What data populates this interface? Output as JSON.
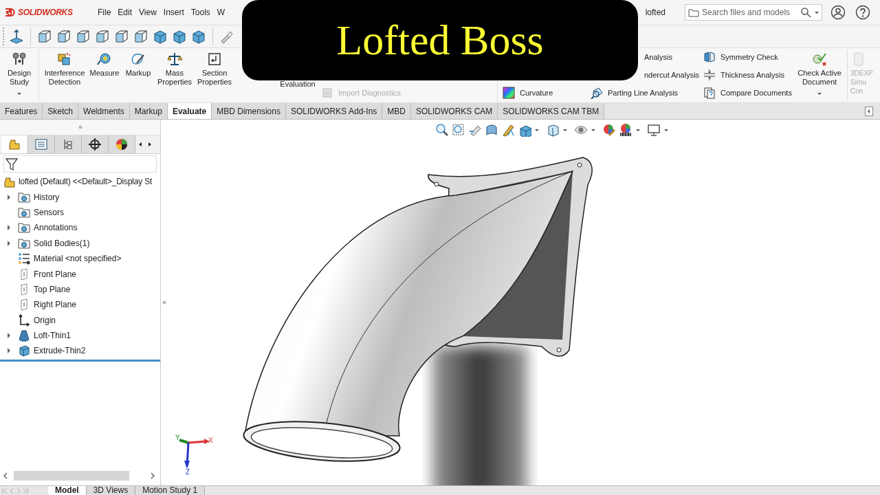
{
  "app": {
    "brand": "SOLIDWORKS",
    "menu": [
      "File",
      "Edit",
      "View",
      "Insert",
      "Tools",
      "W"
    ],
    "document_title": "lofted",
    "search": {
      "placeholder": "Search files and models"
    }
  },
  "banner": {
    "text": "Lofted Boss"
  },
  "command_manager": {
    "large_buttons": [
      {
        "lines": [
          "Design",
          "Study"
        ],
        "dropdown": true,
        "disabled": false
      },
      {
        "lines": [
          "Interference",
          "Detection"
        ],
        "dropdown": false,
        "disabled": false
      },
      {
        "lines": [
          "Measure"
        ],
        "dropdown": false,
        "disabled": false
      },
      {
        "lines": [
          "Markup"
        ],
        "dropdown": false,
        "disabled": false
      },
      {
        "lines": [
          "Mass",
          "Properties"
        ],
        "dropdown": false,
        "disabled": false
      },
      {
        "lines": [
          "Section",
          "Properties"
        ],
        "dropdown": false,
        "disabled": false
      },
      {
        "lines": [
          "Evaluation"
        ],
        "dropdown": false,
        "disabled": false
      }
    ],
    "small_columns": [
      [
        {
          "label": "Import Diagnostics",
          "disabled": true
        }
      ],
      [
        {
          "label": "Curvature",
          "disabled": false
        }
      ],
      [
        {
          "label": "Analysis",
          "disabled": false
        },
        {
          "label": "ndercut Analysis",
          "disabled": false
        },
        {
          "label": "Parting Line Analysis",
          "disabled": false
        }
      ],
      [
        {
          "label": "Symmetry Check",
          "disabled": false
        },
        {
          "label": "Thickness Analysis",
          "disabled": false
        },
        {
          "label": "Compare Documents",
          "disabled": false
        }
      ]
    ],
    "end_buttons": [
      {
        "lines": [
          "Check Active",
          "Document"
        ],
        "dropdown": true,
        "disabled": false
      },
      {
        "lines": [
          "3DEXP",
          "Simu",
          "Con"
        ],
        "dropdown": false,
        "disabled": true
      }
    ]
  },
  "tabs": [
    {
      "label": "Features",
      "selected": false
    },
    {
      "label": "Sketch",
      "selected": false
    },
    {
      "label": "Weldments",
      "selected": false
    },
    {
      "label": "Markup",
      "selected": false
    },
    {
      "label": "Evaluate",
      "selected": true
    },
    {
      "label": "MBD Dimensions",
      "selected": false
    },
    {
      "label": "SOLIDWORKS Add-Ins",
      "selected": false
    },
    {
      "label": "MBD",
      "selected": false
    },
    {
      "label": "SOLIDWORKS CAM",
      "selected": false
    },
    {
      "label": "SOLIDWORKS CAM TBM",
      "selected": false
    }
  ],
  "feature_tree": {
    "panel_tabs": [
      {
        "selected": true
      },
      {
        "selected": false
      },
      {
        "selected": false
      },
      {
        "selected": false
      },
      {
        "selected": false
      }
    ],
    "root": "lofted (Default) <<Default>_Display St",
    "items": [
      {
        "label": "History",
        "kind": "folder",
        "has_children": true
      },
      {
        "label": "Sensors",
        "kind": "folder",
        "has_children": false
      },
      {
        "label": "Annotations",
        "kind": "folder",
        "has_children": true
      },
      {
        "label": "Solid Bodies(1)",
        "kind": "folder",
        "has_children": true
      },
      {
        "label": "Material <not specified>",
        "kind": "material",
        "has_children": false
      },
      {
        "label": "Front Plane",
        "kind": "plane",
        "has_children": false
      },
      {
        "label": "Top Plane",
        "kind": "plane",
        "has_children": false
      },
      {
        "label": "Right Plane",
        "kind": "plane",
        "has_children": false
      },
      {
        "label": "Origin",
        "kind": "origin",
        "has_children": false
      },
      {
        "label": "Loft-Thin1",
        "kind": "loft",
        "has_children": true
      },
      {
        "label": "Extrude-Thin2",
        "kind": "extrude",
        "has_children": true
      }
    ]
  },
  "triad": {
    "x": "X",
    "y": "Y",
    "z": "Z"
  },
  "bottom_tabs": [
    {
      "label": "Model",
      "selected": true
    },
    {
      "label": "3D Views",
      "selected": false
    },
    {
      "label": "Motion Study 1",
      "selected": false
    }
  ]
}
